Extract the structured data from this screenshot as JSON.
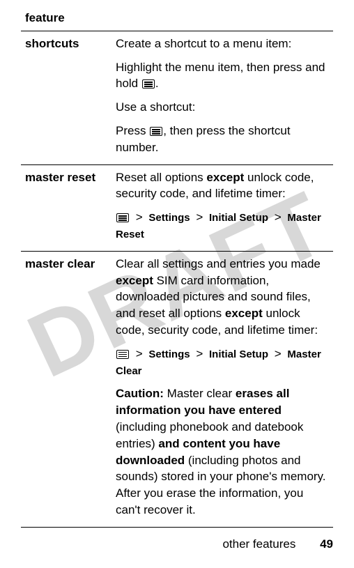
{
  "watermark": "DRAFT",
  "table": {
    "header": "feature",
    "rows": [
      {
        "label": "shortcuts",
        "p1": "Create a shortcut to a menu item:",
        "p2a": "Highlight the menu item, then press and hold ",
        "p2b": ".",
        "p3": "Use a shortcut:",
        "p4a": "Press ",
        "p4b": ", then press the shortcut number."
      },
      {
        "label": "master reset",
        "p1a": "Reset all options ",
        "p1b": "except",
        "p1c": " unlock code, security code, and lifetime timer:",
        "path": {
          "s1": "Settings",
          "s2": "Initial Setup",
          "s3": "Master Reset"
        }
      },
      {
        "label": "master clear",
        "p1a": "Clear all settings and entries you made ",
        "p1b": "except",
        "p1c": " SIM card information, downloaded pictures and sound files, and reset all options ",
        "p1d": "except",
        "p1e": " unlock code, security code, and lifetime timer:",
        "path": {
          "s1": "Settings",
          "s2": "Initial Setup",
          "s3": "Master Clear"
        },
        "caution": {
          "c1": "Caution:",
          "c2": " Master clear ",
          "c3": "erases all information you have entered",
          "c4": " (including phonebook and datebook entries) ",
          "c5": "and content you have downloaded",
          "c6": " (including photos and sounds) stored in your phone's memory. After you erase the information, you can't recover it."
        }
      }
    ]
  },
  "footer": {
    "label": "other features",
    "page": "49"
  },
  "sep": ">"
}
